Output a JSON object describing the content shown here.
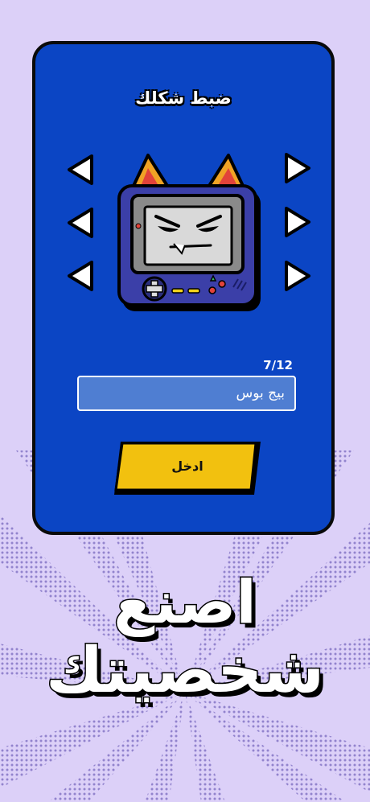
{
  "card": {
    "title": "ضبط شكلك",
    "counter": "7/12",
    "name_value": "بيج بوس",
    "enter_label": "ادخل"
  },
  "arrows": {
    "left_icon": "arrow-left-icon",
    "right_icon": "arrow-right-icon"
  },
  "headline": {
    "line1": "اصنع",
    "line2": "شخصيتك"
  },
  "colors": {
    "background": "#dcd0f8",
    "card": "#0b45c4",
    "button": "#f2c10f",
    "input": "#4f7ed2"
  }
}
